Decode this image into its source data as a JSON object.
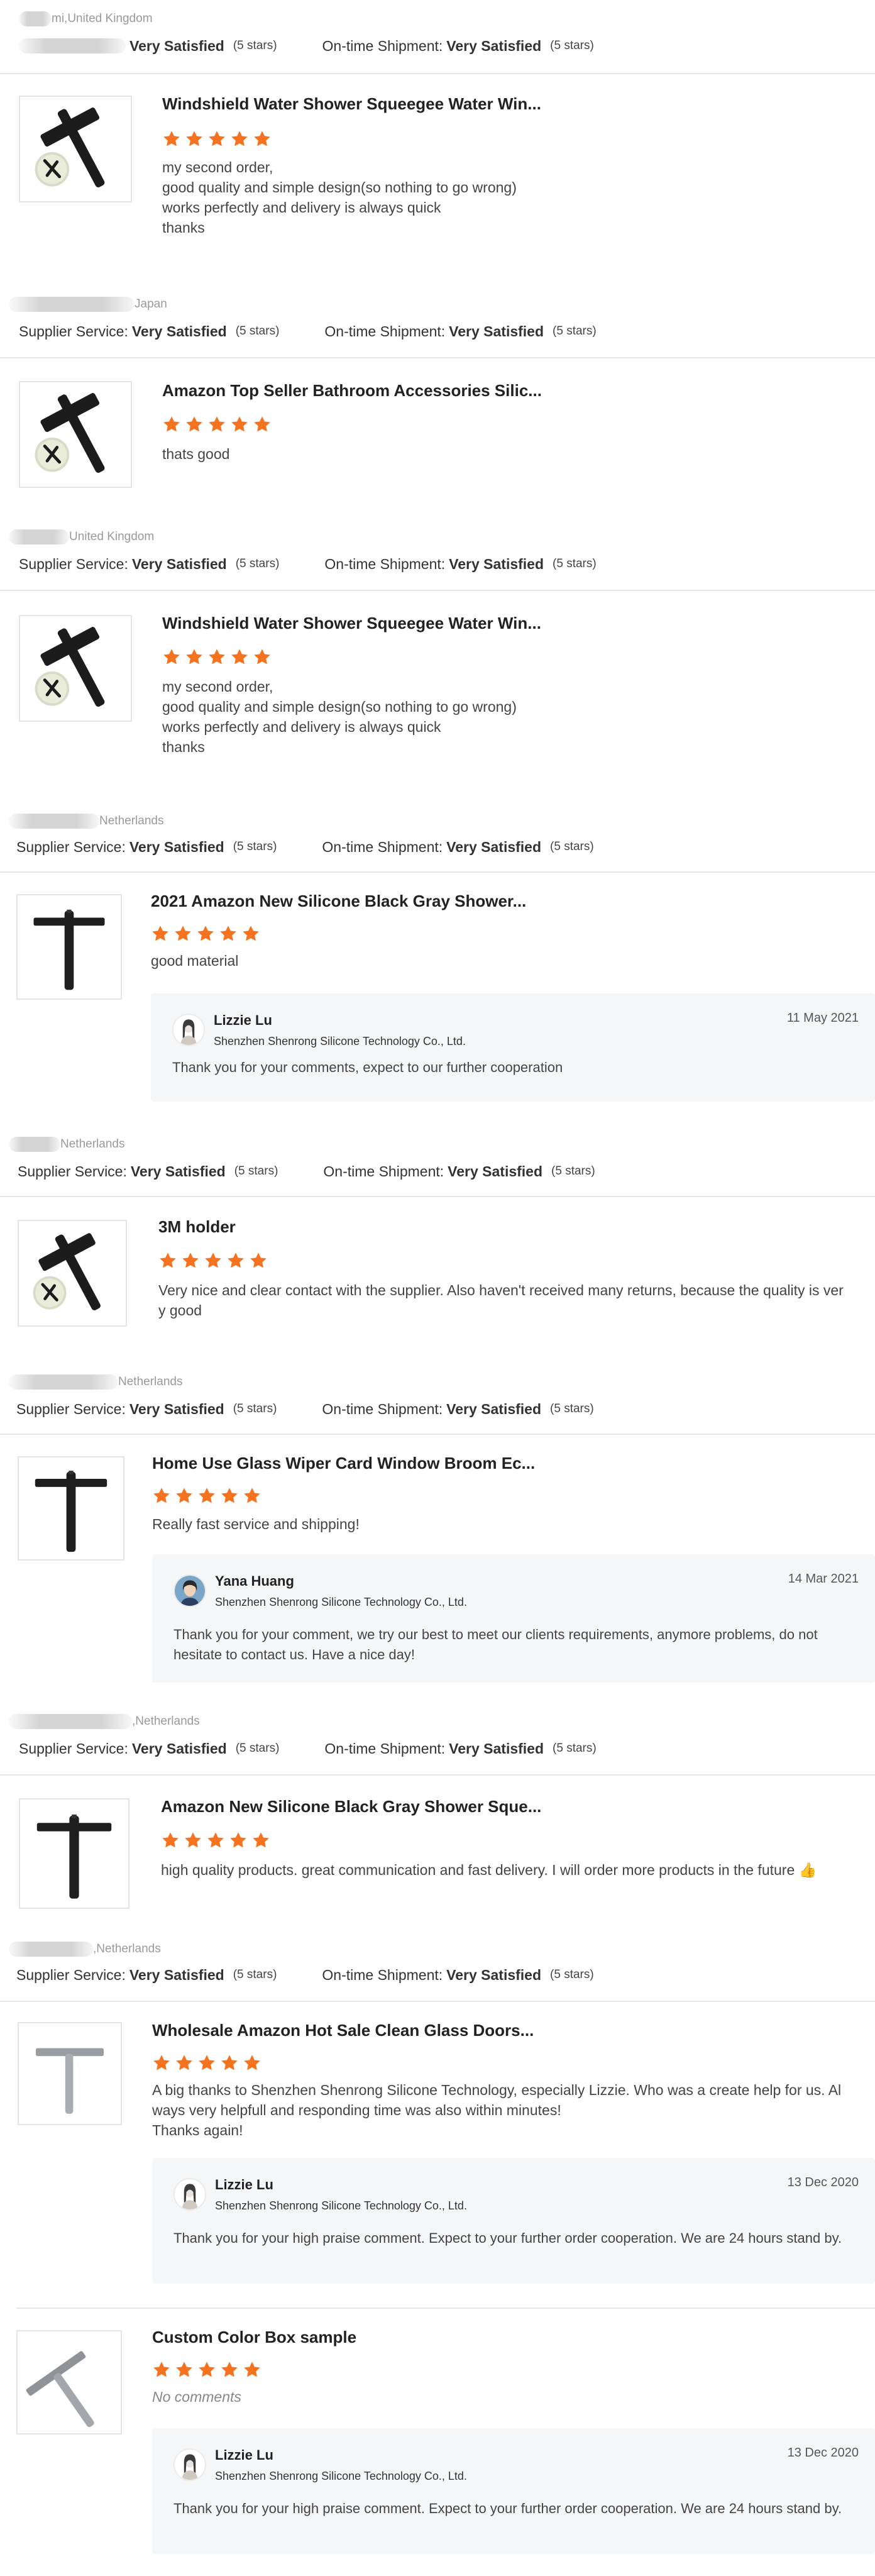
{
  "labels": {
    "supplier_service": "Supplier Service:",
    "ontime_shipment": "On-time Shipment:",
    "very_satisfied": "Very Satisfied",
    "five_stars": "(5 stars)"
  },
  "colors": {
    "star": "#f5721f",
    "divider": "#e6e6e6",
    "reply_bg": "#f5f6f8"
  },
  "reviews": [
    {
      "buyer_suffix": "mi,United Kingdom",
      "supplier_label": "",
      "product_title": "Windshield Water Shower Squeegee Water Win...",
      "stars": 5,
      "comment": "my second order,\ngood quality and simple design(so nothing to go wrong)\nworks perfectly and delivery is always quick\nthanks",
      "image_icon": "squeegee-holder-icon"
    },
    {
      "buyer_suffix": "Japan",
      "supplier_label": "Supplier Service:",
      "product_title": "Amazon Top Seller Bathroom Accessories Silic...",
      "stars": 5,
      "comment": "thats good",
      "image_icon": "squeegee-holder-icon"
    },
    {
      "buyer_suffix": "United Kingdom",
      "supplier_label": "Supplier Service:",
      "product_title": "Windshield Water Shower Squeegee Water Win...",
      "stars": 5,
      "comment": "my second order,\ngood quality and simple design(so nothing to go wrong)\nworks perfectly and delivery is always quick\nthanks",
      "image_icon": "squeegee-holder-icon"
    },
    {
      "buyer_suffix": "Netherlands",
      "supplier_label": "Supplier Service:",
      "product_title": "2021 Amazon New Silicone Black Gray Shower...",
      "stars": 5,
      "comment": "good material",
      "image_icon": "squeegee-icon",
      "reply": {
        "name": "Lizzie Lu",
        "company": "Shenzhen Shenrong Silicone Technology Co., Ltd.",
        "date": "11 May 2021",
        "text": "Thank you for your comments, expect to our further cooperation",
        "avatar_icon": "woman-avatar-icon"
      }
    },
    {
      "buyer_suffix": "Netherlands",
      "supplier_label": "Supplier Service:",
      "product_title": "3M holder",
      "stars": 5,
      "comment": "Very nice and clear contact with the supplier. Also haven't received many returns, because the quality is ver\ny good",
      "image_icon": "squeegee-holder-icon"
    },
    {
      "buyer_suffix": "Netherlands",
      "supplier_label": "Supplier Service:",
      "product_title": "Home Use Glass Wiper Card Window Broom Ec...",
      "stars": 5,
      "comment": "Really fast service and shipping!",
      "image_icon": "squeegee-icon",
      "reply": {
        "name": "Yana Huang",
        "company": "Shenzhen Shenrong Silicone Technology Co., Ltd.",
        "date": "14 Mar 2021",
        "text": "Thank you for your comment, we try our best to meet our clients requirements, anymore problems, do not hesitate to contact us. Have a nice day!",
        "avatar_icon": "woman-photo-avatar-icon"
      }
    },
    {
      "buyer_suffix": ",Netherlands",
      "supplier_label": "Supplier Service:",
      "product_title": "Amazon New Silicone Black Gray Shower Sque...",
      "stars": 5,
      "comment": "high quality products. great communication and fast delivery. I will order more products in the future 👍",
      "image_icon": "squeegee-icon"
    },
    {
      "buyer_suffix": ",Netherlands",
      "supplier_label": "Supplier Service:",
      "product_title": "Wholesale Amazon Hot Sale Clean Glass Doors...",
      "stars": 5,
      "comment": "A big thanks to Shenzhen Shenrong Silicone Technology, especially Lizzie. Who was a create help for us. Al\nways very helpfull and responding time was also within minutes!\nThanks again!",
      "image_icon": "gray-squeegee-icon",
      "reply": {
        "name": "Lizzie Lu",
        "company": "Shenzhen Shenrong Silicone Technology Co., Ltd.",
        "date": "13 Dec 2020",
        "text": "Thank you for your high praise comment. Expect to your further order cooperation. We are 24 hours stand by.",
        "avatar_icon": "woman-avatar-icon"
      }
    },
    {
      "buyer_suffix": "",
      "supplier_label": "",
      "product_title": "Custom Color Box sample",
      "stars": 5,
      "comment": "No comments",
      "image_icon": "gray-squeegee-angled-icon",
      "reply": {
        "name": "Lizzie Lu",
        "company": "Shenzhen Shenrong Silicone Technology Co., Ltd.",
        "date": "13 Dec 2020",
        "text": "Thank you for your high praise comment. Expect to your further order cooperation. We are 24 hours stand by.",
        "avatar_icon": "woman-avatar-icon"
      }
    }
  ]
}
